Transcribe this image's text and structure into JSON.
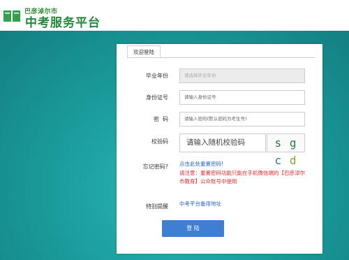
{
  "header": {
    "logo_small": "巴彦淖尔市",
    "logo_big": "中考服务平台",
    "logo_icon": "book-icon",
    "brand_color": "#1f8a3a"
  },
  "login": {
    "tab_title": "欢迎登陆",
    "graduation_year": {
      "label": "毕业年份",
      "placeholder": "请选择毕业年份"
    },
    "id_number": {
      "label": "身份证号",
      "placeholder": "请输入身份证号"
    },
    "password": {
      "label": "密  码",
      "placeholder": "请输入密码(默认密码为考生号)"
    },
    "captcha": {
      "label": "校验码",
      "placeholder": "请输入随机校验码",
      "chars": [
        "s",
        "g",
        "c",
        "d"
      ],
      "colors": [
        "#2a7c3a",
        "#2a7c3a",
        "#3570b8",
        "#8aa51f"
      ]
    },
    "forgot": {
      "label": "忘记密码?",
      "link_text": "点击此处重置密码!",
      "notice": "请注意：重置密码功能只能在手机微信端的【巴彦淖尔市教育】公众账号中使用"
    },
    "special": {
      "label": "特别提醒",
      "link_text": "中考平台备用地址"
    },
    "submit_label": "登 陆",
    "accent_color": "#3f7fd1"
  }
}
